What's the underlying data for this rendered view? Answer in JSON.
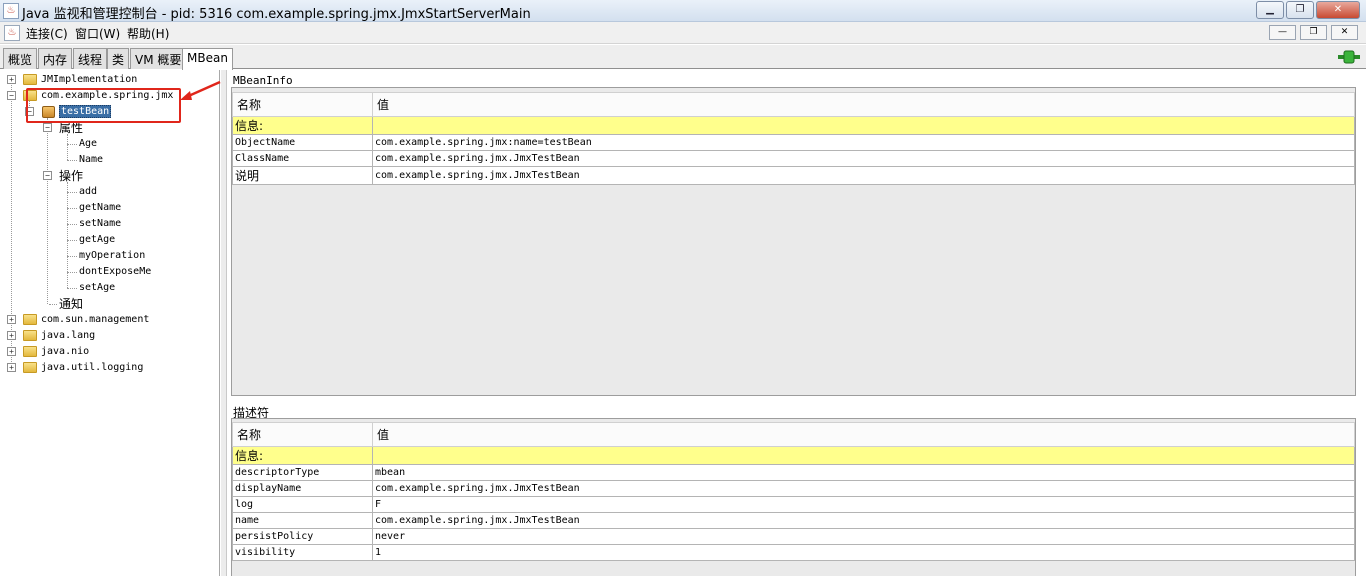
{
  "window": {
    "title": "Java 监视和管理控制台 - pid: 5316 com.example.spring.jmx.JmxStartServerMain",
    "minimize": "▁",
    "maximize": "❐",
    "close": "✕"
  },
  "menu": {
    "items": [
      "连接(C)",
      "窗口(W)",
      "帮助(H)"
    ],
    "inner_controls": [
      "—",
      "❐",
      "✕"
    ]
  },
  "tabs": [
    {
      "label": "概览",
      "active": false
    },
    {
      "label": "内存",
      "active": false
    },
    {
      "label": "线程",
      "active": false
    },
    {
      "label": "类",
      "active": false
    },
    {
      "label": "VM 概要",
      "active": false
    },
    {
      "label": "MBean",
      "active": true
    }
  ],
  "tree": {
    "nodes": [
      {
        "label": "JMImplementation",
        "level": 0,
        "kind": "folder",
        "expanded": false
      },
      {
        "label": "com.example.spring.jmx",
        "level": 0,
        "kind": "folder",
        "expanded": true
      },
      {
        "label": "testBean",
        "level": 1,
        "kind": "bean",
        "expanded": true,
        "selected": true
      },
      {
        "label": "属性",
        "level": 2,
        "kind": "group",
        "expanded": true
      },
      {
        "label": "Age",
        "level": 3,
        "kind": "leaf"
      },
      {
        "label": "Name",
        "level": 3,
        "kind": "leaf"
      },
      {
        "label": "操作",
        "level": 2,
        "kind": "group",
        "expanded": true
      },
      {
        "label": "add",
        "level": 3,
        "kind": "leaf"
      },
      {
        "label": "getName",
        "level": 3,
        "kind": "leaf"
      },
      {
        "label": "setName",
        "level": 3,
        "kind": "leaf"
      },
      {
        "label": "getAge",
        "level": 3,
        "kind": "leaf"
      },
      {
        "label": "myOperation",
        "level": 3,
        "kind": "leaf"
      },
      {
        "label": "dontExposeMe",
        "level": 3,
        "kind": "leaf"
      },
      {
        "label": "setAge",
        "level": 3,
        "kind": "leaf"
      },
      {
        "label": "通知",
        "level": 2,
        "kind": "group-leaf"
      },
      {
        "label": "com.sun.management",
        "level": 0,
        "kind": "folder",
        "expanded": false
      },
      {
        "label": "java.lang",
        "level": 0,
        "kind": "folder",
        "expanded": false
      },
      {
        "label": "java.nio",
        "level": 0,
        "kind": "folder",
        "expanded": false
      },
      {
        "label": "java.util.logging",
        "level": 0,
        "kind": "folder",
        "expanded": false
      }
    ]
  },
  "mbean_info": {
    "title": "MBeanInfo",
    "header": {
      "name": "名称",
      "value": "值"
    },
    "info_label": "信息:",
    "rows": [
      {
        "name": "ObjectName",
        "value": "com.example.spring.jmx:name=testBean"
      },
      {
        "name": "ClassName",
        "value": "com.example.spring.jmx.JmxTestBean"
      },
      {
        "name": "说明",
        "value": "com.example.spring.jmx.JmxTestBean"
      }
    ]
  },
  "descriptor": {
    "title": "描述符",
    "header": {
      "name": "名称",
      "value": "值"
    },
    "info_label": "信息:",
    "rows": [
      {
        "name": "descriptorType",
        "value": "mbean"
      },
      {
        "name": "displayName",
        "value": "com.example.spring.jmx.JmxTestBean"
      },
      {
        "name": "log",
        "value": "F"
      },
      {
        "name": "name",
        "value": "com.example.spring.jmx.JmxTestBean"
      },
      {
        "name": "persistPolicy",
        "value": "never"
      },
      {
        "name": "visibility",
        "value": "1"
      }
    ]
  },
  "colors": {
    "info_row": "#ffff8c",
    "selection": "#3a6ea5",
    "annotation": "#e0261b"
  }
}
